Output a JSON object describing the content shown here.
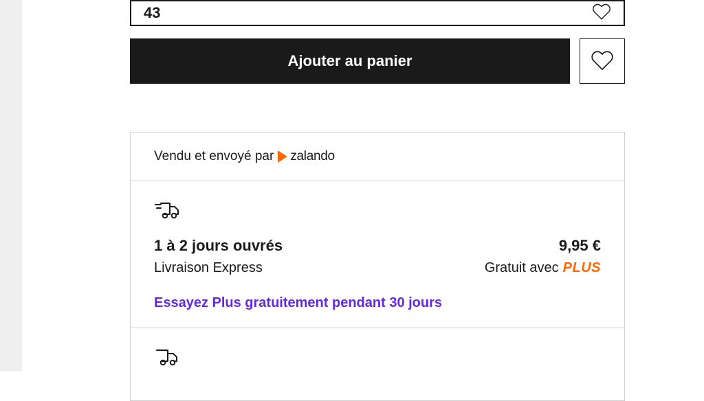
{
  "size_selector": {
    "value": "43"
  },
  "actions": {
    "add_to_cart_label": "Ajouter au panier"
  },
  "seller": {
    "prefix": "Vendu et envoyé par",
    "brand": "zalando"
  },
  "shipping": {
    "express": {
      "duration": "1 à 2 jours ouvrés",
      "price": "9,95 €",
      "type": "Livraison Express",
      "free_with_label": "Gratuit avec",
      "plus_badge": "PLUS",
      "try_plus_link": "Essayez Plus gratuitement pendant 30 jours"
    }
  }
}
